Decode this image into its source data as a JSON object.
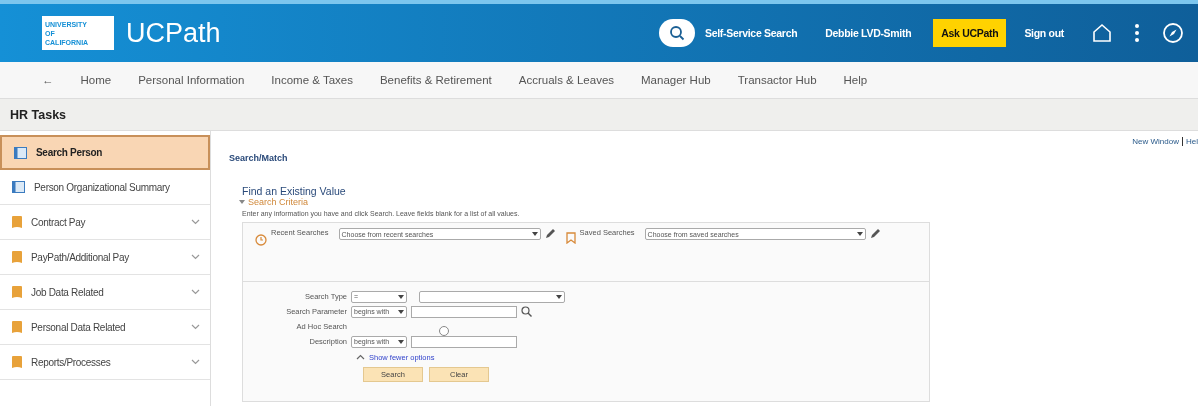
{
  "header": {
    "logo_text": "UNIVERSITY OF CALIFORNIA",
    "app_name": "UCPath",
    "search_label": "Self-Service Search",
    "user_name": "Debbie LVD-Smith",
    "ask_button": "Ask UCPath",
    "sign_out": "Sign out"
  },
  "nav": {
    "back": "←",
    "items": [
      "Home",
      "Personal Information",
      "Income & Taxes",
      "Benefits & Retirement",
      "Accruals & Leaves",
      "Manager Hub",
      "Transactor Hub",
      "Help"
    ]
  },
  "page_title": "HR Tasks",
  "sidebar": {
    "items": [
      {
        "label": "Search Person",
        "kind": "page",
        "selected": true
      },
      {
        "label": "Person Organizational Summary",
        "kind": "page",
        "selected": false
      },
      {
        "label": "Contract Pay",
        "kind": "folder",
        "selected": false
      },
      {
        "label": "PayPath/Additional Pay",
        "kind": "folder",
        "selected": false
      },
      {
        "label": "Job Data Related",
        "kind": "folder",
        "selected": false
      },
      {
        "label": "Personal Data Related",
        "kind": "folder",
        "selected": false
      },
      {
        "label": "Reports/Processes",
        "kind": "folder",
        "selected": false
      }
    ]
  },
  "top_links": [
    "New Window",
    "Hel"
  ],
  "content": {
    "breadcrumb": "Search/Match",
    "heading": "Find an Existing Value",
    "section": "Search Criteria",
    "instructions": "Enter any information you have and click Search. Leave fields blank for a list of all values.",
    "recent": {
      "label": "Recent Searches",
      "placeholder": "Choose from recent searches"
    },
    "saved": {
      "label": "Saved Searches",
      "placeholder": "Choose from saved searches"
    },
    "search_type": {
      "label": "Search Type",
      "operator": "="
    },
    "search_parameter": {
      "label": "Search Parameter",
      "operator": "begins with"
    },
    "ad_hoc": {
      "label": "Ad Hoc Search",
      "checked": false
    },
    "description": {
      "label": "Description",
      "operator": "begins with"
    },
    "fewer_options": "Show fewer options",
    "buttons": [
      "Search",
      "Clear"
    ]
  }
}
